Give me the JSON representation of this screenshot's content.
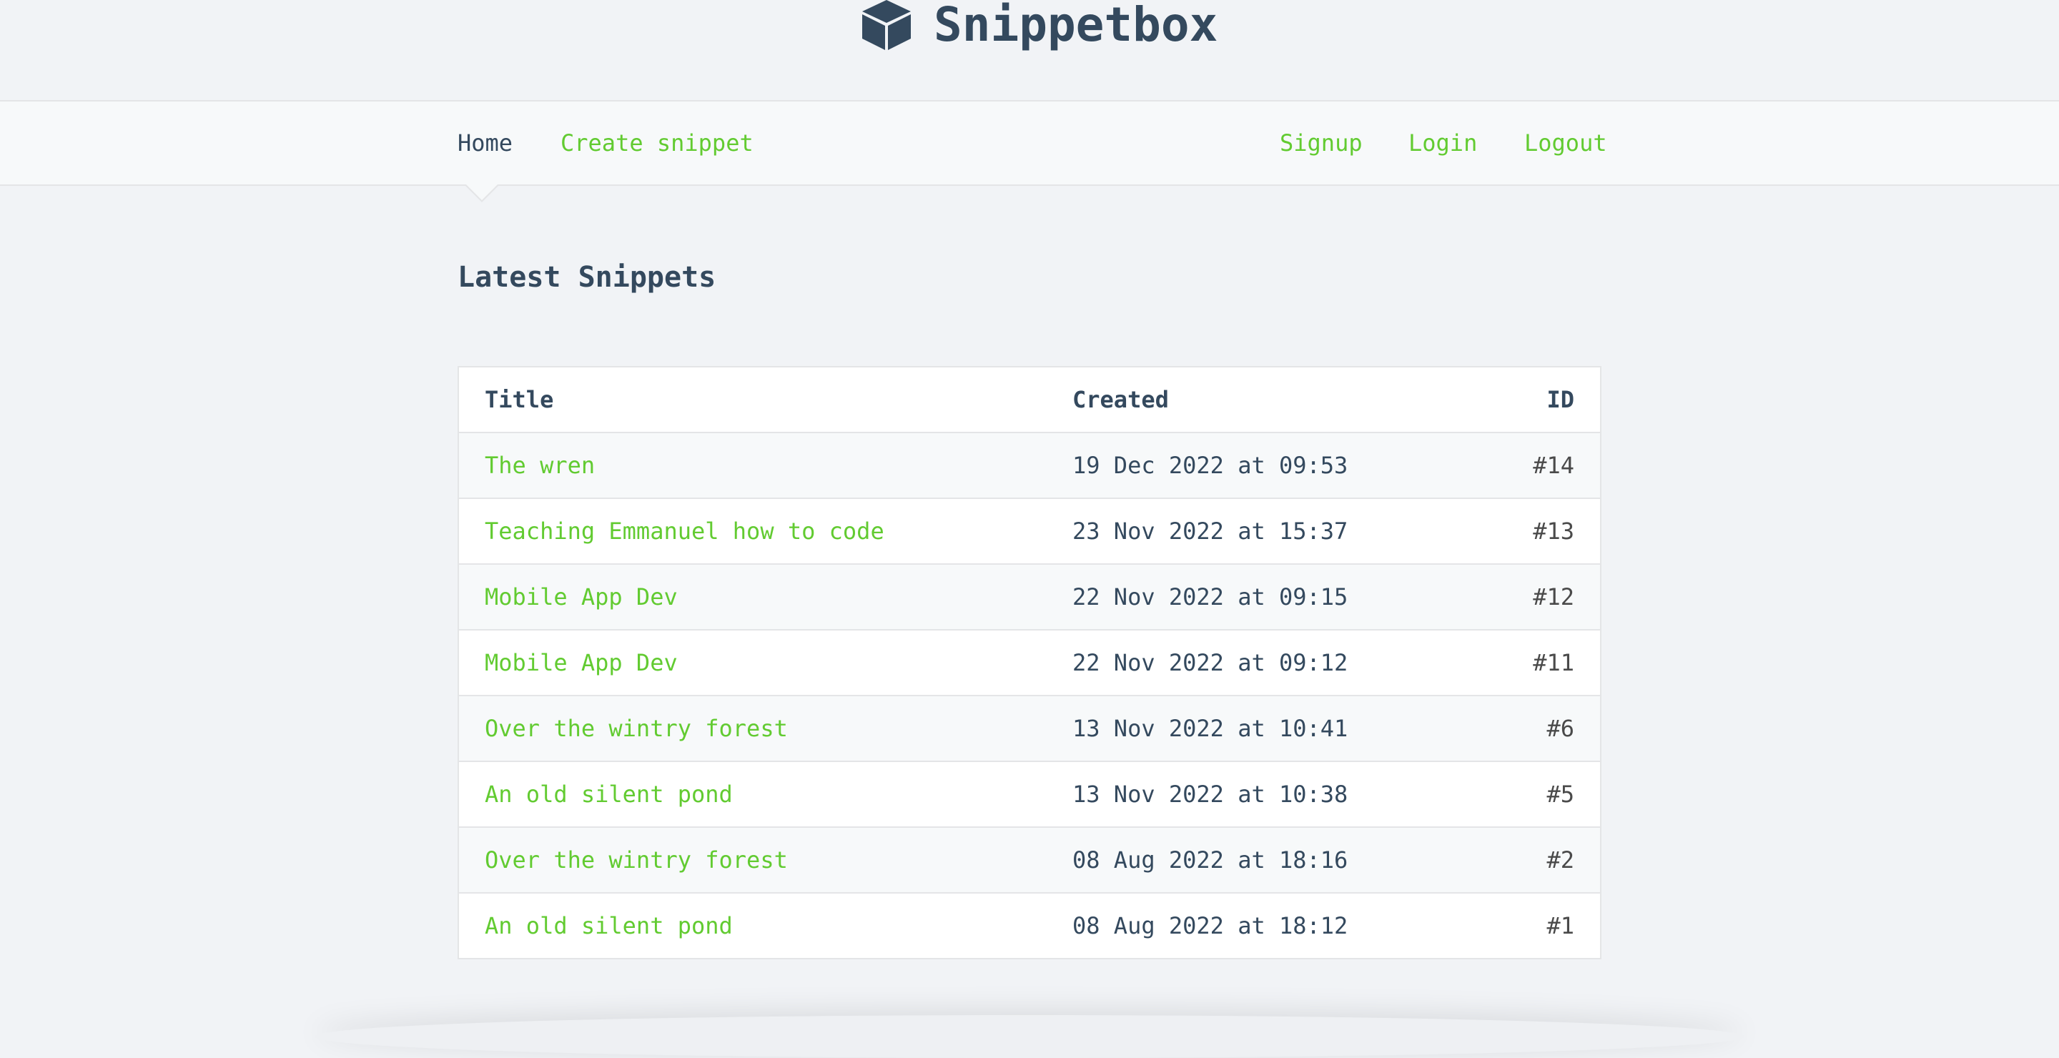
{
  "header": {
    "brand": "Snippetbox",
    "brand_icon": "cube-icon"
  },
  "nav": {
    "left": [
      {
        "label": "Home",
        "active": true
      },
      {
        "label": "Create snippet",
        "active": false
      }
    ],
    "right": [
      {
        "label": "Signup"
      },
      {
        "label": "Login"
      },
      {
        "label": "Logout"
      }
    ]
  },
  "main": {
    "heading": "Latest Snippets",
    "table": {
      "columns": [
        "Title",
        "Created",
        "ID"
      ],
      "rows": [
        {
          "title": "The wren",
          "created": "19 Dec 2022 at 09:53",
          "id": "#14"
        },
        {
          "title": "Teaching Emmanuel how to code",
          "created": "23 Nov 2022 at 15:37",
          "id": "#13"
        },
        {
          "title": "Mobile App Dev",
          "created": "22 Nov 2022 at 09:15",
          "id": "#12"
        },
        {
          "title": "Mobile App Dev",
          "created": "22 Nov 2022 at 09:12",
          "id": "#11"
        },
        {
          "title": "Over the wintry forest",
          "created": "13 Nov 2022 at 10:41",
          "id": "#6"
        },
        {
          "title": "An old silent pond",
          "created": "13 Nov 2022 at 10:38",
          "id": "#5"
        },
        {
          "title": "Over the wintry forest",
          "created": "08 Aug 2022 at 18:16",
          "id": "#2"
        },
        {
          "title": "An old silent pond",
          "created": "08 Aug 2022 at 18:12",
          "id": "#1"
        }
      ]
    }
  },
  "colors": {
    "accent": "#62cb31",
    "text": "#34495e",
    "background": "#f1f3f6"
  }
}
